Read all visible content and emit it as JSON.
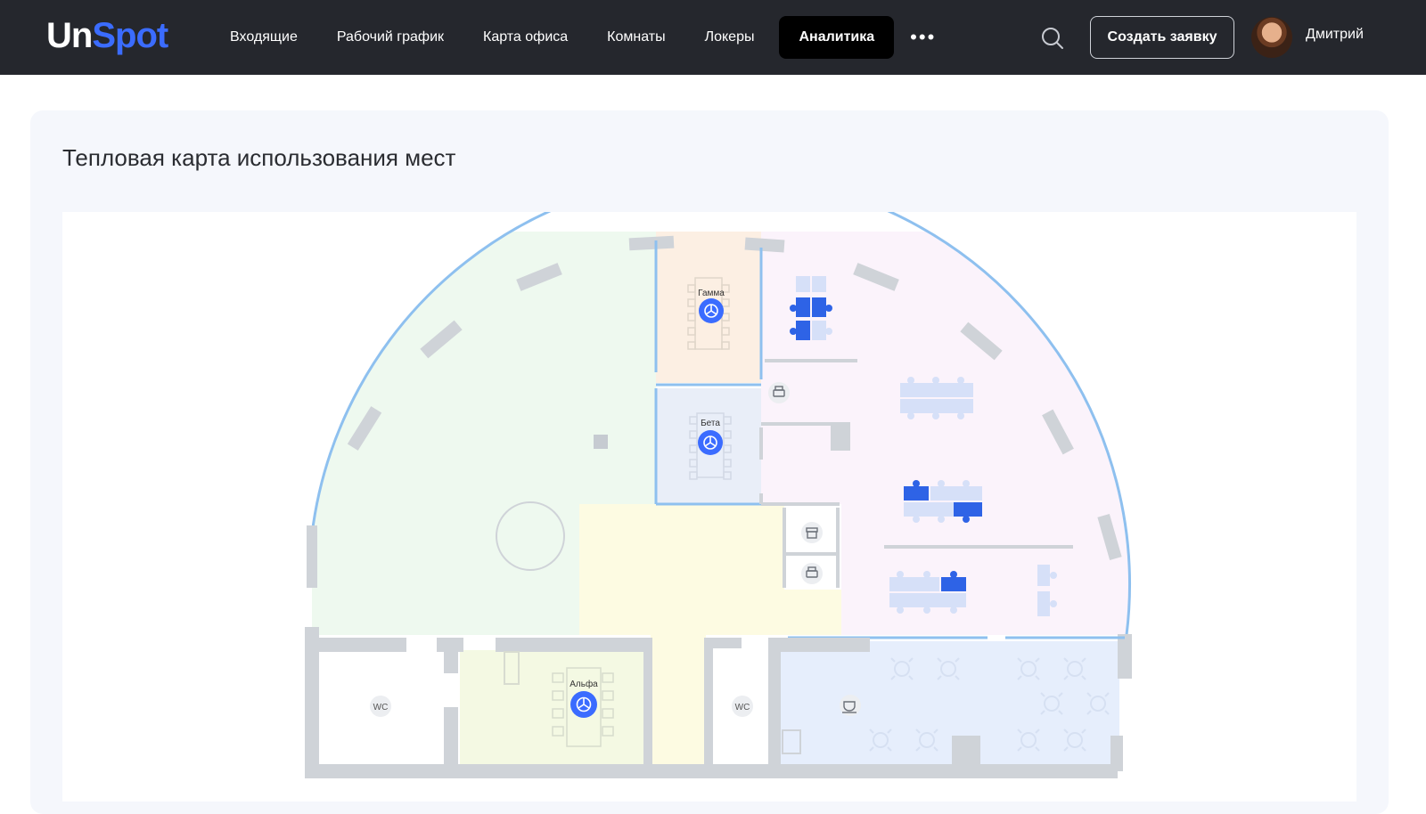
{
  "header": {
    "logo_un": "Un",
    "logo_spot": "Spot",
    "nav": [
      {
        "label": "Входящие"
      },
      {
        "label": "Рабочий график"
      },
      {
        "label": "Карта офиса"
      },
      {
        "label": "Комнаты"
      },
      {
        "label": "Локеры"
      },
      {
        "label": "Аналитика",
        "active": true
      }
    ],
    "more_label": "•••",
    "search_icon": "search-icon",
    "create_button": "Создать заявку",
    "user_name": "Дмитрий"
  },
  "page": {
    "title": "Тепловая карта использования мест"
  },
  "map": {
    "rooms": [
      {
        "name": "Гамма"
      },
      {
        "name": "Бета"
      },
      {
        "name": "Альфа"
      }
    ],
    "wc_label": "WC",
    "zone_colors": {
      "open_space": "#eef9ef",
      "gamma": "#fcefe3",
      "beta": "#e9eef8",
      "lobby": "#fdfbe2",
      "desks_area": "#fbf3fb",
      "alpha": "#f4f9e3",
      "kitchen": "#e6eefc",
      "booked_desk": "#2e63e6",
      "free_desk": "#d6e0f8"
    },
    "icons": [
      "printer-icon",
      "archive-icon",
      "coffee-icon",
      "meeting-room-icon"
    ]
  }
}
